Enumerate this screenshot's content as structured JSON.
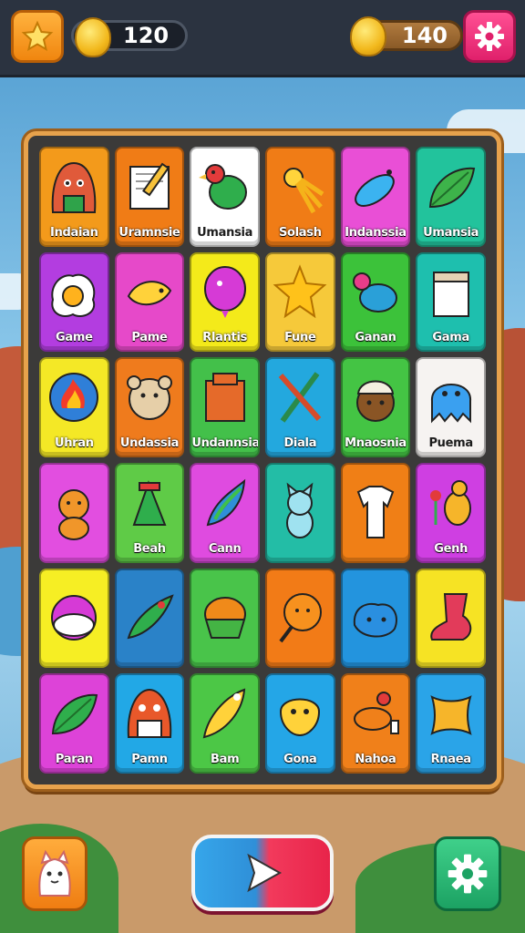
{
  "hud": {
    "left_counter": "120",
    "right_counter": "140",
    "icons": [
      "star-icon",
      "bell-coin-icon",
      "coin-icon",
      "gear-icon"
    ]
  },
  "board": {
    "tiles": [
      {
        "label": "Indaian",
        "icon": "hooded-face-icon",
        "color": "#f39a1b"
      },
      {
        "label": "Uramnsie",
        "icon": "notepad-pencil-icon",
        "color": "#f07c16"
      },
      {
        "label": "Umansia",
        "icon": "parrot-icon",
        "color": "#ffffff"
      },
      {
        "label": "Solash",
        "icon": "sun-rocket-icon",
        "color": "#f07c16"
      },
      {
        "label": "Indanssia",
        "icon": "blue-fish-icon",
        "color": "#e94fd6"
      },
      {
        "label": "Umansia",
        "icon": "leaf-icon",
        "color": "#22c39c"
      },
      {
        "label": "Game",
        "icon": "fried-egg-icon",
        "color": "#b33de0"
      },
      {
        "label": "Pame",
        "icon": "yellow-fish-icon",
        "color": "#e649c9"
      },
      {
        "label": "Rlantis",
        "icon": "balloon-icon",
        "color": "#f4ea1a"
      },
      {
        "label": "Fune",
        "icon": "star-icon",
        "color": "#f6c93a"
      },
      {
        "label": "Ganan",
        "icon": "bird-icon",
        "color": "#3cc23a"
      },
      {
        "label": "Gama",
        "icon": "box-icon",
        "color": "#1ebfae"
      },
      {
        "label": "Uhran",
        "icon": "fire-ball-icon",
        "color": "#f4e826"
      },
      {
        "label": "Undassia",
        "icon": "bear-face-icon",
        "color": "#ef7b1d"
      },
      {
        "label": "Undannsia",
        "icon": "crate-icon",
        "color": "#43c04a"
      },
      {
        "label": "Diala",
        "icon": "crossed-sticks-icon",
        "color": "#23a8de"
      },
      {
        "label": "Mnaosnia",
        "icon": "acorn-face-icon",
        "color": "#44c444"
      },
      {
        "label": "Puema",
        "icon": "blue-octopus-icon",
        "color": "#f6f3f1"
      },
      {
        "label": "",
        "icon": "bear-icon",
        "color": "#e24ee0"
      },
      {
        "label": "Beah",
        "icon": "green-bundle-icon",
        "color": "#5fcb47"
      },
      {
        "label": "Cann",
        "icon": "carrot-leaf-icon",
        "color": "#df4be0"
      },
      {
        "label": "",
        "icon": "cat-icon",
        "color": "#23bda6"
      },
      {
        "label": "",
        "icon": "shirt-icon",
        "color": "#f07f16"
      },
      {
        "label": "Genh",
        "icon": "squirrel-flower-icon",
        "color": "#cf3fe2"
      },
      {
        "label": "",
        "icon": "bowl-icon",
        "color": "#f6ee24"
      },
      {
        "label": "",
        "icon": "green-rocket-icon",
        "color": "#2a82c8"
      },
      {
        "label": "",
        "icon": "green-face-icon",
        "color": "#49c44a"
      },
      {
        "label": "",
        "icon": "orange-lollipop-icon",
        "color": "#f27b17"
      },
      {
        "label": "",
        "icon": "blue-blob-icon",
        "color": "#2394de"
      },
      {
        "label": "",
        "icon": "red-boot-icon",
        "color": "#f6e324"
      },
      {
        "label": "Paran",
        "icon": "green-leaf-icon",
        "color": "#dd43d8"
      },
      {
        "label": "Pamn",
        "icon": "orange-hood-icon",
        "color": "#22a8e6"
      },
      {
        "label": "Bam",
        "icon": "yellow-rocket-icon",
        "color": "#4cc746"
      },
      {
        "label": "Gona",
        "icon": "yellow-face-icon",
        "color": "#24a6e7"
      },
      {
        "label": "Nahoa",
        "icon": "orange-bowl-icon",
        "color": "#f0801a"
      },
      {
        "label": "Rnaea",
        "icon": "pillow-icon",
        "color": "#2aa4e8"
      }
    ]
  },
  "bottom": {
    "left_icon": "ghost-character-icon",
    "center_icon": "play-arrow-icon",
    "right_icon": "gear-icon"
  }
}
